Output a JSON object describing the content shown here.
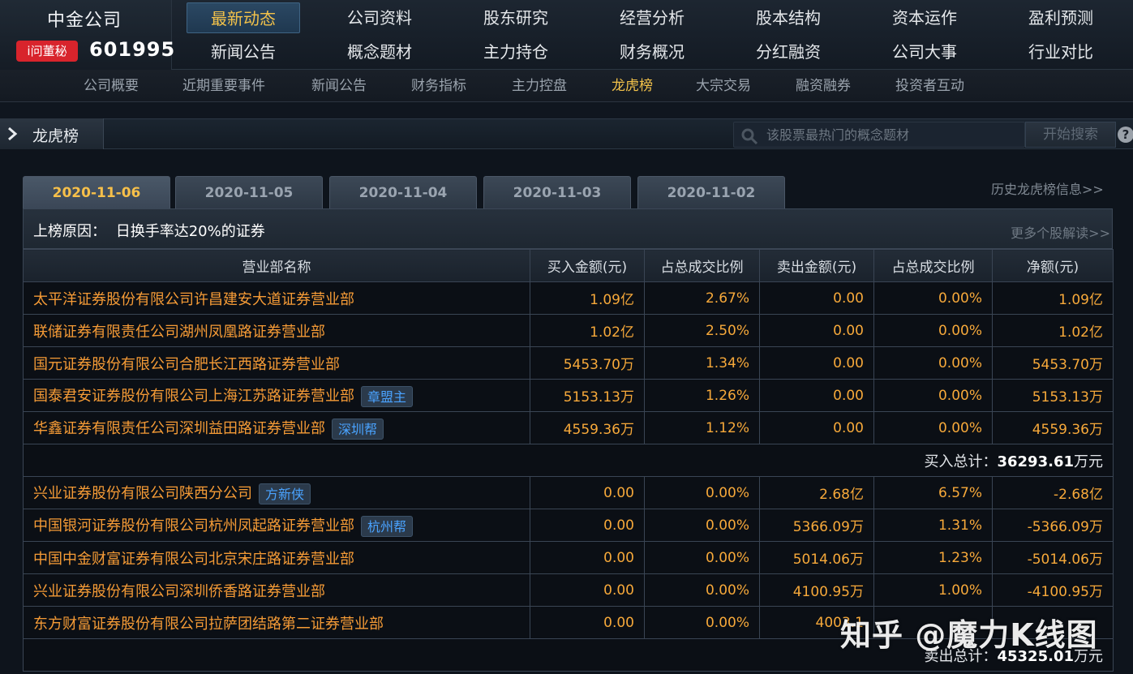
{
  "header": {
    "company_name": "中金公司",
    "badge": "i问董秘",
    "stock_code": "601995",
    "nav_row1": [
      "最新动态",
      "公司资料",
      "股东研究",
      "经营分析",
      "股本结构",
      "资本运作",
      "盈利预测"
    ],
    "nav_row2": [
      "新闻公告",
      "概念题材",
      "主力持仓",
      "财务概况",
      "分红融资",
      "公司大事",
      "行业对比"
    ],
    "active_nav": "最新动态"
  },
  "sub_nav": {
    "items": [
      "公司概要",
      "近期重要事件",
      "新闻公告",
      "财务指标",
      "主力控盘",
      "龙虎榜",
      "大宗交易",
      "融资融券",
      "投资者互动"
    ],
    "active": "龙虎榜"
  },
  "section": {
    "title": "龙虎榜",
    "search_placeholder": "该股票最热门的概念题材",
    "search_button": "开始搜索",
    "help": "?"
  },
  "dates": {
    "tabs": [
      "2020-11-06",
      "2020-11-05",
      "2020-11-04",
      "2020-11-03",
      "2020-11-02"
    ],
    "active": "2020-11-06",
    "history_link": "历史龙虎榜信息>>"
  },
  "reason": {
    "label": "上榜原因：",
    "text": "日换手率达20%的证券",
    "more": "更多个股解读>>"
  },
  "table": {
    "headers": [
      "营业部名称",
      "买入金额(元)",
      "占总成交比例",
      "卖出金额(元)",
      "占总成交比例",
      "净额(元)"
    ],
    "buy_rows": [
      {
        "name": "太平洋证券股份有限公司许昌建安大道证券营业部",
        "tag": "",
        "buy": "1.09亿",
        "buy_pct": "2.67%",
        "sell": "0.00",
        "sell_pct": "0.00%",
        "net": "1.09亿"
      },
      {
        "name": "联储证券有限责任公司湖州凤凰路证券营业部",
        "tag": "",
        "buy": "1.02亿",
        "buy_pct": "2.50%",
        "sell": "0.00",
        "sell_pct": "0.00%",
        "net": "1.02亿"
      },
      {
        "name": "国元证券股份有限公司合肥长江西路证券营业部",
        "tag": "",
        "buy": "5453.70万",
        "buy_pct": "1.34%",
        "sell": "0.00",
        "sell_pct": "0.00%",
        "net": "5453.70万"
      },
      {
        "name": "国泰君安证券股份有限公司上海江苏路证券营业部",
        "tag": "章盟主",
        "buy": "5153.13万",
        "buy_pct": "1.26%",
        "sell": "0.00",
        "sell_pct": "0.00%",
        "net": "5153.13万"
      },
      {
        "name": "华鑫证券有限责任公司深圳益田路证券营业部",
        "tag": "深圳帮",
        "buy": "4559.36万",
        "buy_pct": "1.12%",
        "sell": "0.00",
        "sell_pct": "0.00%",
        "net": "4559.36万"
      }
    ],
    "buy_total": {
      "label": "买入总计：",
      "value": "36293.61",
      "unit": "万元"
    },
    "sell_rows": [
      {
        "name": "兴业证券股份有限公司陕西分公司",
        "tag": "方新侠",
        "buy": "0.00",
        "buy_pct": "0.00%",
        "sell": "2.68亿",
        "sell_pct": "6.57%",
        "net": "-2.68亿"
      },
      {
        "name": "中国银河证券股份有限公司杭州凤起路证券营业部",
        "tag": "杭州帮",
        "buy": "0.00",
        "buy_pct": "0.00%",
        "sell": "5366.09万",
        "sell_pct": "1.31%",
        "net": "-5366.09万"
      },
      {
        "name": "中国中金财富证券有限公司北京宋庄路证券营业部",
        "tag": "",
        "buy": "0.00",
        "buy_pct": "0.00%",
        "sell": "5014.06万",
        "sell_pct": "1.23%",
        "net": "-5014.06万"
      },
      {
        "name": "兴业证券股份有限公司深圳侨香路证券营业部",
        "tag": "",
        "buy": "0.00",
        "buy_pct": "0.00%",
        "sell": "4100.95万",
        "sell_pct": "1.00%",
        "net": "-4100.95万"
      },
      {
        "name": "东方财富证券股份有限公司拉萨团结路第二证券营业部",
        "tag": "",
        "buy": "0.00",
        "buy_pct": "0.00%",
        "sell": "4003.1",
        "sell_pct": "",
        "net": ""
      }
    ],
    "sell_total": {
      "label": "卖出总计：",
      "value": "45325.01",
      "unit": "万元"
    }
  },
  "watermark": "知乎 @魔力K线图",
  "colors": {
    "accent": "#f3c24a",
    "name_text": "#f59b36",
    "value_text": "#f7a93a",
    "tag_text": "#4aa3ff",
    "badge": "#d8242c"
  }
}
